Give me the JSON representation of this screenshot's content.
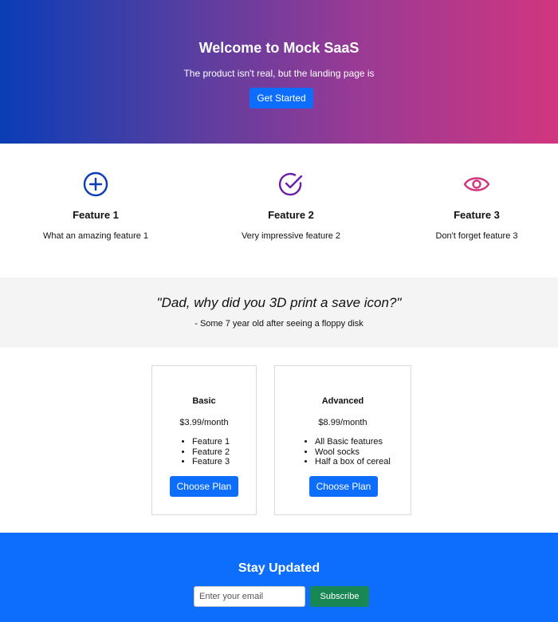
{
  "hero": {
    "title": "Welcome to Mock SaaS",
    "subtitle": "The product isn't real, but the landing page is",
    "cta_label": "Get Started"
  },
  "features": [
    {
      "icon": "plus-circle-icon",
      "title": "Feature 1",
      "description": "What an amazing feature 1",
      "color": "#0a3db6"
    },
    {
      "icon": "check-circle-icon",
      "title": "Feature 2",
      "description": "Very impressive feature 2",
      "color": "#6a1fa8"
    },
    {
      "icon": "eye-icon",
      "title": "Feature 3",
      "description": "Don't forget feature 3",
      "color": "#d1367f"
    }
  ],
  "testimonial": {
    "quote": "\"Dad, why did you 3D print a save icon?\"",
    "attribution": "- Some 7 year old after seeing a floppy disk"
  },
  "pricing": {
    "plans": [
      {
        "name": "Basic",
        "price": "$3.99/month",
        "features": [
          "Feature 1",
          "Feature 2",
          "Feature 3"
        ],
        "button_label": "Choose Plan"
      },
      {
        "name": "Advanced",
        "price": "$8.99/month",
        "features": [
          "All Basic features",
          "Wool socks",
          "Half a box of cereal"
        ],
        "button_label": "Choose Plan"
      }
    ]
  },
  "newsletter": {
    "title": "Stay Updated",
    "email_placeholder": "Enter your email",
    "subscribe_label": "Subscribe"
  },
  "colors": {
    "primary": "#0d6efd",
    "success": "#198754",
    "hero_gradient_start": "#0a3db6",
    "hero_gradient_end": "#d1367f"
  }
}
